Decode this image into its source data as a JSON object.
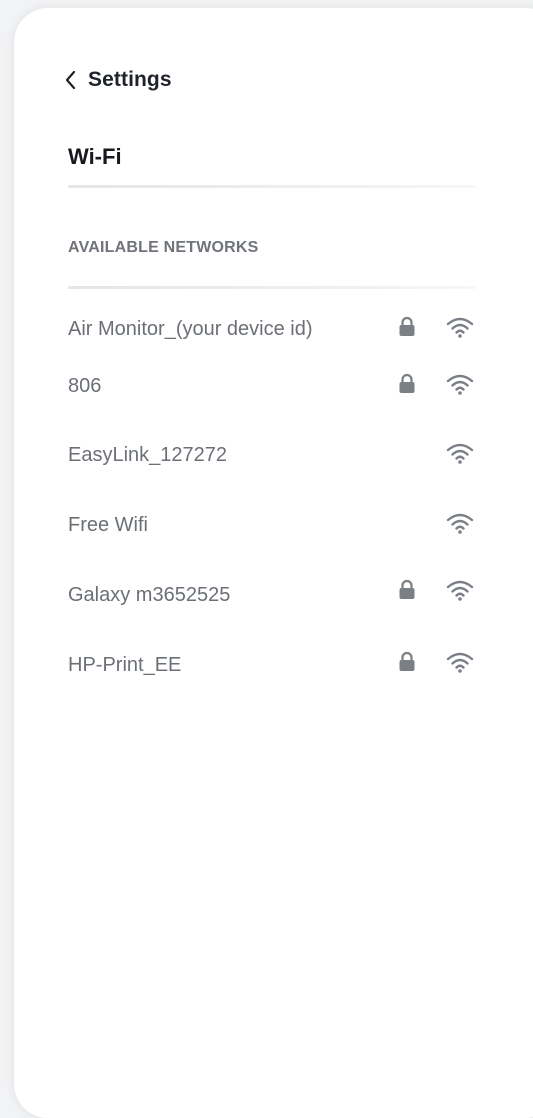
{
  "header": {
    "back_label": "Settings",
    "title": "Wi-Fi"
  },
  "section": {
    "label": "AVAILABLE NETWORKS"
  },
  "networks": [
    {
      "name": "Air Monitor_(your device id)",
      "locked": true
    },
    {
      "name": "806",
      "locked": true
    },
    {
      "name": "EasyLink_127272",
      "locked": false
    },
    {
      "name": "Free Wifi",
      "locked": false
    },
    {
      "name": "Galaxy m3652525",
      "locked": true
    },
    {
      "name": "HP-Print_EE",
      "locked": true
    }
  ],
  "icons": {
    "back": "chevron-left-icon",
    "lock": "lock-icon",
    "signal": "wifi-icon"
  },
  "colors": {
    "icon": "#7b7f86",
    "text_secondary": "#6b6f76",
    "text_primary": "#1f2329"
  }
}
